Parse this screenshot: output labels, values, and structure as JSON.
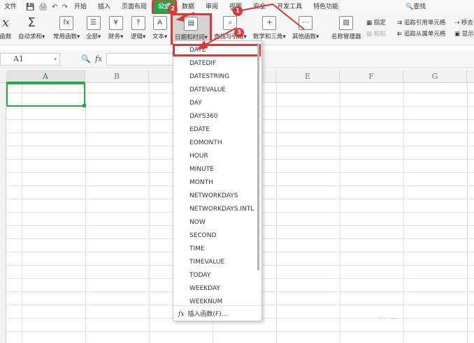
{
  "menubar": {
    "file": "文件",
    "tabs": [
      "开始",
      "插入",
      "页面布局",
      "公式",
      "数据",
      "审阅",
      "视图",
      "安全",
      "开发工具",
      "特色功能"
    ],
    "active_tab": "公式",
    "search": "查找"
  },
  "ribbon": {
    "fx_label": "函数",
    "autosum": "自动求和",
    "common": "常用函数",
    "all": "全部",
    "finance": "财务",
    "logic": "逻辑",
    "text": "文本",
    "datetime": "日期和时间",
    "lookup": "查找与引用",
    "math": "数学和三角",
    "other": "其他函数",
    "name_manager": "名称管理器",
    "assign": "指定",
    "paste": "粘贴",
    "trace_precedents": "追踪引用单元格",
    "trace_dependents": "追踪从属单元格",
    "move": "移去",
    "show": "显示"
  },
  "formula_bar": {
    "cell_ref": "A1",
    "fx": "fx"
  },
  "grid": {
    "columns": [
      "A",
      "B",
      "C",
      "D",
      "E",
      "F",
      "G"
    ],
    "selected_column": "A"
  },
  "dropdown": {
    "items": [
      "DATE",
      "DATEDIF",
      "DATESTRING",
      "DATEVALUE",
      "DAY",
      "DAYS360",
      "EDATE",
      "EOMONTH",
      "HOUR",
      "MINUTE",
      "MONTH",
      "NETWORKDAYS",
      "NETWORKDAYS.INTL",
      "NOW",
      "SECOND",
      "TIME",
      "TIMEVALUE",
      "TODAY",
      "WEEKDAY",
      "WEEKNUM"
    ],
    "highlighted": "DATE",
    "footer": "插入函数(F)..."
  },
  "annotations": [
    "1",
    "2",
    "3"
  ],
  "colors": {
    "accent": "#1fa84a",
    "highlight": "#e03636"
  }
}
